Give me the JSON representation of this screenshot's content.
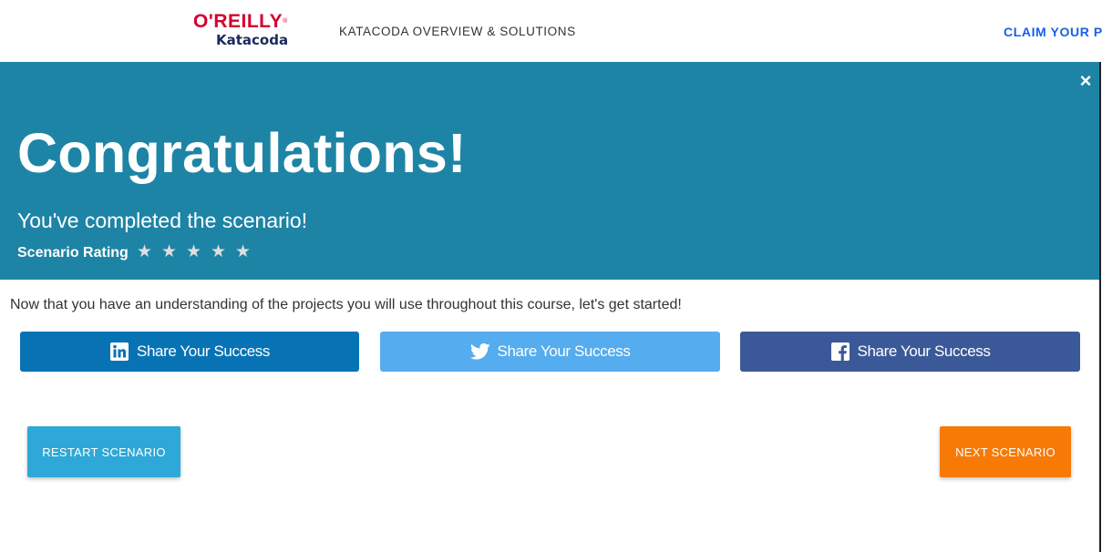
{
  "header": {
    "logo_top": "O'REILLY",
    "logo_registered": "®",
    "logo_bottom": "Katacoda",
    "nav_link": "KATACODA OVERVIEW & SOLUTIONS",
    "claim_link": "CLAIM YOUR PR"
  },
  "banner": {
    "close_icon": "×",
    "title": "Congratulations!",
    "subtitle": "You've completed the scenario!",
    "rating_label": "Scenario Rating",
    "star_glyph": "★",
    "star_count": 5,
    "background_color": "#1e84a5"
  },
  "main": {
    "description": "Now that you have an understanding of the projects you will use throughout this course, let's get started!"
  },
  "share": {
    "linkedin": {
      "label": "Share Your Success",
      "icon": "linkedin-icon",
      "color": "#0873b4"
    },
    "twitter": {
      "label": "Share Your Success",
      "icon": "twitter-icon",
      "color": "#55acee"
    },
    "facebook": {
      "label": "Share Your Success",
      "icon": "facebook-icon",
      "color": "#3b5998"
    }
  },
  "actions": {
    "restart_label": "RESTART SCENARIO",
    "next_label": "NEXT SCENARIO",
    "restart_color": "#2ea8d8",
    "next_color": "#f77a07"
  }
}
